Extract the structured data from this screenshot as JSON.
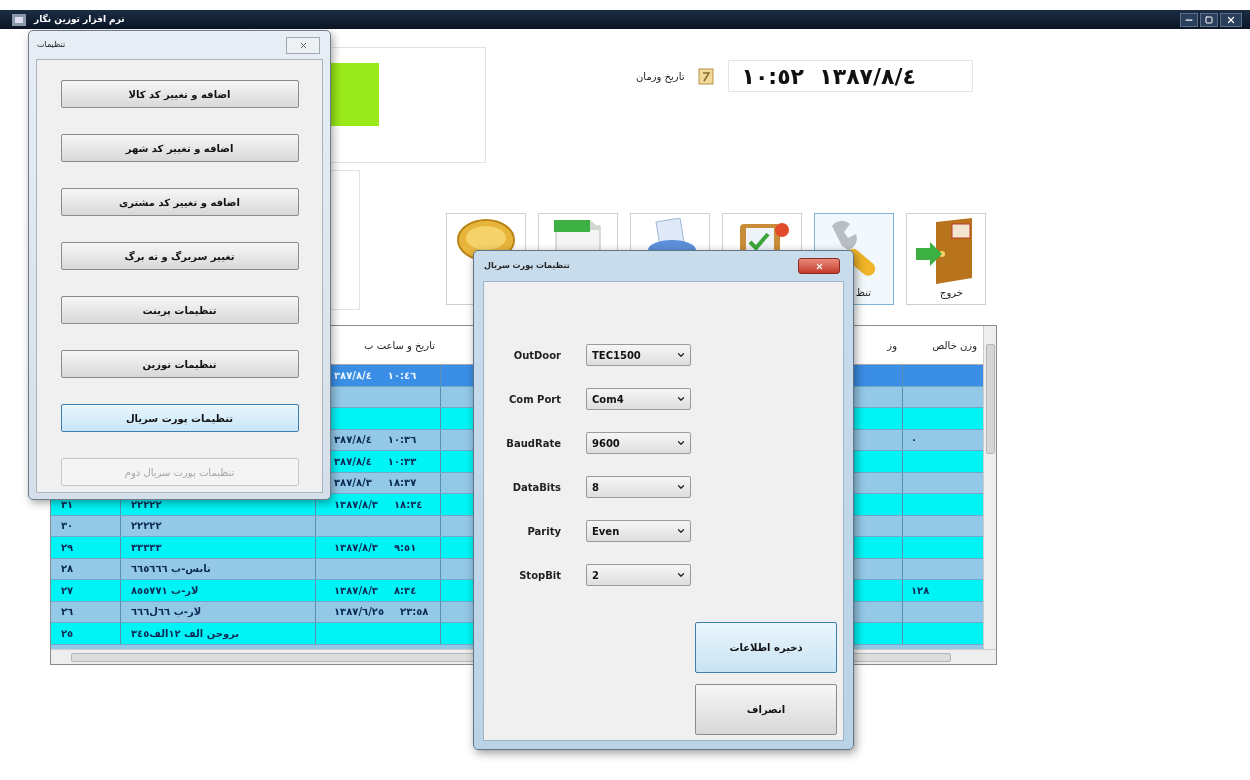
{
  "window": {
    "title": "نرم افزار توزین نگار"
  },
  "datetime": {
    "label": "تاریخ وزمان",
    "value": "١٣٨٧/٨/٤  ١٠:٥٢"
  },
  "toolbar": [
    {
      "kind": "exit",
      "label": "خروج",
      "selected": false
    },
    {
      "kind": "tools",
      "label": "تنظ",
      "selected": true
    },
    {
      "kind": "clipboard",
      "selected": false
    },
    {
      "kind": "printer",
      "selected": false
    },
    {
      "kind": "sheet",
      "selected": false
    },
    {
      "kind": "coins",
      "selected": false
    }
  ],
  "table": {
    "columns": [
      {
        "label": "وزن خالص"
      },
      {
        "label": "وز"
      },
      {
        "label": "تاریخ و ساعت ب"
      }
    ],
    "rows": [
      {
        "selected": true,
        "date": "٣٨٧/٨/٤",
        "time": "١٠:٤٦"
      },
      {
        "selected": false
      },
      {
        "selected": false
      },
      {
        "selected": false,
        "date": "٣٨٧/٨/٤",
        "time": "١٠:٣٦",
        "net": "٠"
      },
      {
        "selected": false,
        "date": "٣٨٧/٨/٤",
        "time": "١٠:٣٣"
      },
      {
        "selected": false,
        "date": "٣٨٧/٨/٣",
        "time": "١٨:٣٧"
      },
      {
        "selected": false,
        "number": "٣١",
        "plate": "٢٢٢٢٢",
        "date": "١٣٨٧/٨/٣",
        "time": "١٨:٣٤"
      },
      {
        "selected": false,
        "number": "٣٠",
        "plate": "٢٢٢٢٢"
      },
      {
        "selected": false,
        "number": "٢٩",
        "plate": "٣٣٣٣٣",
        "date": "١٣٨٧/٨/٣",
        "time": "٩:٥١"
      },
      {
        "selected": false,
        "number": "٢٨",
        "plate": "نابس-ب ٦٦٥٦٦٦"
      },
      {
        "selected": false,
        "number": "٢٧",
        "plate": "لار-ب ٨٥٥٧٧١",
        "date": "١٣٨٧/٨/٣",
        "time": "٨:٣٤",
        "net": "١٢٨"
      },
      {
        "selected": false,
        "number": "٢٦",
        "plate": "لار-ب ٦٦ل٦٦٦",
        "date": "١٣٨٧/٦/٢٥",
        "time": "٢٣:٥٨"
      },
      {
        "selected": false,
        "number": "٢٥",
        "plate": "بروجن الف ١٢الف٣٤٥"
      }
    ]
  },
  "settings_window": {
    "title": "تنظیمات",
    "buttons": [
      {
        "label": "اضافه و تغییر کد کالا",
        "focused": false,
        "disabled": false
      },
      {
        "label": "اضافه و تغییر کد شهر",
        "focused": false,
        "disabled": false
      },
      {
        "label": "اضافه و تغییر کد مشتری",
        "focused": false,
        "disabled": false
      },
      {
        "label": "تغییر سربرگ و ته برگ",
        "focused": false,
        "disabled": false
      },
      {
        "label": "تنظیمات پرینت",
        "focused": false,
        "disabled": false
      },
      {
        "label": "تنظیمات توزین",
        "focused": false,
        "disabled": false
      },
      {
        "label": "تنظیمات پورت سریال",
        "focused": true,
        "disabled": false
      },
      {
        "label": "تنظیمات پورت سریال دوم",
        "focused": false,
        "disabled": true
      }
    ]
  },
  "serial_dialog": {
    "title": "تنظیمات پورت سریال",
    "fields": [
      {
        "label": "OutDoor",
        "value": "TEC1500"
      },
      {
        "label": "Com Port",
        "value": "Com4"
      },
      {
        "label": "BaudRate",
        "value": "9600"
      },
      {
        "label": "DataBits",
        "value": "8"
      },
      {
        "label": "Parity",
        "value": "Even"
      },
      {
        "label": "StopBit",
        "value": "2"
      }
    ],
    "buttons": [
      {
        "label": "ذخیره اطلاعات",
        "focused": true
      },
      {
        "label": "انصراف",
        "focused": false
      }
    ]
  }
}
